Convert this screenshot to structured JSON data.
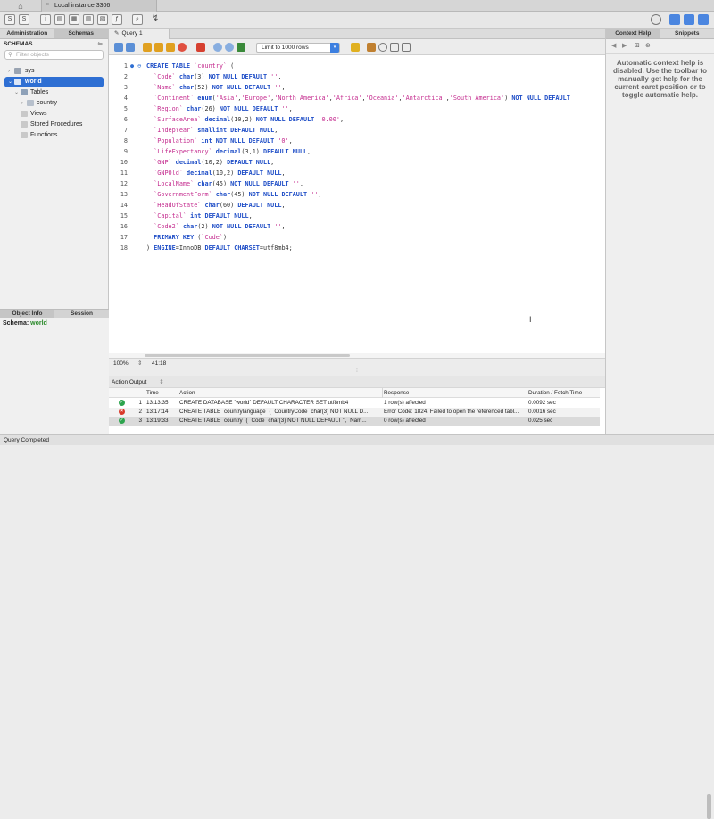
{
  "titlebar": {
    "home_icon": "home-icon",
    "connection_tab": "Local instance 3306"
  },
  "sidebar": {
    "tabs": [
      "Administration",
      "Schemas"
    ],
    "schemas_header": "SCHEMAS",
    "filter_placeholder": "Filter objects",
    "tree": [
      {
        "label": "sys"
      },
      {
        "label": "world"
      },
      {
        "label": "Tables"
      },
      {
        "label": "country"
      },
      {
        "label": "Views"
      },
      {
        "label": "Stored Procedures"
      },
      {
        "label": "Functions"
      }
    ],
    "object_info_tabs": [
      "Object Info",
      "Session"
    ],
    "schema_label": "Schema:",
    "schema_value": "world"
  },
  "query_tab": {
    "label": "Query 1"
  },
  "editor_toolbar": {
    "limit_label": "Limit to 1000 rows"
  },
  "editor": {
    "lines": [
      {
        "n": "1",
        "html": "<span class=\"kw\">CREATE TABLE</span> <span class=\"str\">`country`</span> ("
      },
      {
        "n": "2",
        "html": "  <span class=\"str\">`Code`</span> <span class=\"kw\">char</span>(3) <span class=\"kw\">NOT NULL DEFAULT</span> <span class=\"str\">''</span>,"
      },
      {
        "n": "3",
        "html": "  <span class=\"str\">`Name`</span> <span class=\"kw\">char</span>(52) <span class=\"kw\">NOT NULL DEFAULT</span> <span class=\"str\">''</span>,"
      },
      {
        "n": "4",
        "html": "  <span class=\"str\">`Continent`</span> <span class=\"kw\">enum</span>(<span class=\"str\">'Asia'</span>,<span class=\"str\">'Europe'</span>,<span class=\"str\">'North America'</span>,<span class=\"str\">'Africa'</span>,<span class=\"str\">'Oceania'</span>,<span class=\"str\">'Antarctica'</span>,<span class=\"str\">'South America'</span>) <span class=\"kw\">NOT NULL DEFAULT</span>"
      },
      {
        "n": "5",
        "html": "  <span class=\"str\">`Region`</span> <span class=\"kw\">char</span>(26) <span class=\"kw\">NOT NULL DEFAULT</span> <span class=\"str\">''</span>,"
      },
      {
        "n": "6",
        "html": "  <span class=\"str\">`SurfaceArea`</span> <span class=\"kw\">decimal</span>(10,2) <span class=\"kw\">NOT NULL DEFAULT</span> <span class=\"str\">'0.00'</span>,"
      },
      {
        "n": "7",
        "html": "  <span class=\"str\">`IndepYear`</span> <span class=\"kw\">smallint DEFAULT NULL</span>,"
      },
      {
        "n": "8",
        "html": "  <span class=\"str\">`Population`</span> <span class=\"kw\">int NOT NULL DEFAULT</span> <span class=\"str\">'0'</span>,"
      },
      {
        "n": "9",
        "html": "  <span class=\"str\">`LifeExpectancy`</span> <span class=\"kw\">decimal</span>(3,1) <span class=\"kw\">DEFAULT NULL</span>,"
      },
      {
        "n": "10",
        "html": "  <span class=\"str\">`GNP`</span> <span class=\"kw\">decimal</span>(10,2) <span class=\"kw\">DEFAULT NULL</span>,"
      },
      {
        "n": "11",
        "html": "  <span class=\"str\">`GNPOld`</span> <span class=\"kw\">decimal</span>(10,2) <span class=\"kw\">DEFAULT NULL</span>,"
      },
      {
        "n": "12",
        "html": "  <span class=\"str\">`LocalName`</span> <span class=\"kw\">char</span>(45) <span class=\"kw\">NOT NULL DEFAULT</span> <span class=\"str\">''</span>,"
      },
      {
        "n": "13",
        "html": "  <span class=\"str\">`GovernmentForm`</span> <span class=\"kw\">char</span>(45) <span class=\"kw\">NOT NULL DEFAULT</span> <span class=\"str\">''</span>,"
      },
      {
        "n": "14",
        "html": "  <span class=\"str\">`HeadOfState`</span> <span class=\"kw\">char</span>(60) <span class=\"kw\">DEFAULT NULL</span>,"
      },
      {
        "n": "15",
        "html": "  <span class=\"str\">`Capital`</span> <span class=\"kw\">int DEFAULT NULL</span>,"
      },
      {
        "n": "16",
        "html": "  <span class=\"str\">`Code2`</span> <span class=\"kw\">char</span>(2) <span class=\"kw\">NOT NULL DEFAULT</span> <span class=\"str\">''</span>,"
      },
      {
        "n": "17",
        "html": "  <span class=\"kw\">PRIMARY KEY</span> (<span class=\"str\">`Code`</span>)"
      },
      {
        "n": "18",
        "html": ") <span class=\"kw\">ENGINE</span>=InnoDB <span class=\"kw\">DEFAULT CHARSET</span>=utf8mb4;"
      }
    ]
  },
  "statusline": {
    "zoom": "100%",
    "position": "41:18"
  },
  "output": {
    "header": "Action Output",
    "columns": [
      "Time",
      "Action",
      "Response",
      "Duration / Fetch Time"
    ],
    "rows": [
      {
        "status": "ok",
        "n": "1",
        "time": "13:13:35",
        "action": "CREATE DATABASE `world` DEFAULT CHARACTER SET utf8mb4",
        "response": "1 row(s) affected",
        "duration": "0.0092 sec"
      },
      {
        "status": "err",
        "n": "2",
        "time": "13:17:14",
        "action": "CREATE TABLE `countrylanguage` (  `CountryCode` char(3) NOT NULL D...",
        "response": "Error Code: 1824. Failed to open the referenced tabl...",
        "duration": "0.0016 sec"
      },
      {
        "status": "ok",
        "n": "3",
        "time": "13:19:33",
        "action": "CREATE TABLE `country` (  `Code` char(3) NOT NULL DEFAULT '',  `Nam...",
        "response": "0 row(s) affected",
        "duration": "0.025 sec"
      }
    ]
  },
  "right_panel": {
    "tabs": [
      "Context Help",
      "Snippets"
    ],
    "help_text": "Automatic context help is disabled. Use the toolbar to manually get help for the current caret position or to toggle automatic help."
  },
  "bottom_status": "Query Completed",
  "colors": {
    "accent": "#2e6fd3",
    "ok": "#2da44e",
    "error": "#d93a2b",
    "keyword": "#1f4ec7",
    "string": "#c42b8e"
  }
}
